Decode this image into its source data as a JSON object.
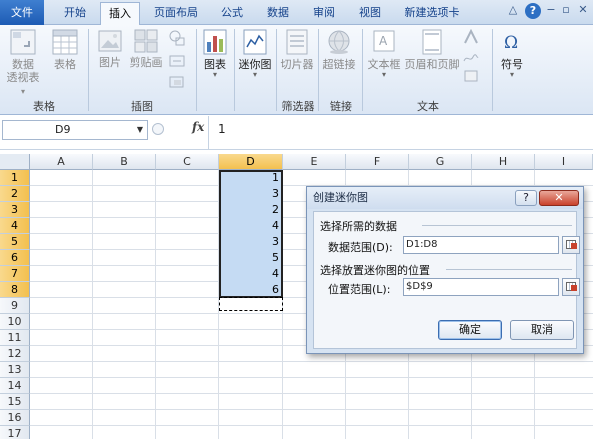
{
  "tabs": [
    {
      "label": "文件"
    },
    {
      "label": "开始"
    },
    {
      "label": "插入"
    },
    {
      "label": "页面布局"
    },
    {
      "label": "公式"
    },
    {
      "label": "数据"
    },
    {
      "label": "审阅"
    },
    {
      "label": "视图"
    },
    {
      "label": "新建选项卡"
    }
  ],
  "window_controls": {
    "caret": "△",
    "help": "?",
    "minimize": "−",
    "restore": "▫",
    "close": "✕"
  },
  "ribbon": {
    "pivot_label_1": "数据",
    "pivot_label_2": "透视表",
    "table": "表格",
    "picture": "图片",
    "clipart": "剪贴画",
    "chart": "图表",
    "sparkline": "迷你图",
    "slicer": "切片器",
    "hyperlink": "超链接",
    "textbox": "文本框",
    "header_footer": "页眉和页脚",
    "symbol": "符号",
    "groups": {
      "tables": "表格",
      "illustrations": "插图",
      "filter": "筛选器",
      "links": "链接",
      "text": "文本"
    }
  },
  "formula_bar": {
    "name_box": "D9",
    "fx": "fx",
    "value": "1"
  },
  "grid": {
    "columns": [
      "A",
      "B",
      "C",
      "D",
      "E",
      "F",
      "G",
      "H",
      "I"
    ],
    "rows": [
      "1",
      "2",
      "3",
      "4",
      "5",
      "6",
      "7",
      "8",
      "9",
      "10",
      "11",
      "12",
      "13",
      "14",
      "15",
      "16",
      "17"
    ],
    "d_values": [
      "1",
      "3",
      "2",
      "4",
      "3",
      "5",
      "4",
      "6"
    ]
  },
  "dialog": {
    "title": "创建迷你图",
    "help": "?",
    "close": "✕",
    "data_section": "选择所需的数据",
    "data_range_label": "数据范围(D):",
    "data_range_value": "D1:D8",
    "location_section": "选择放置迷你图的位置",
    "location_range_label": "位置范围(L):",
    "location_range_value": "$D$9",
    "ok": "确定",
    "cancel": "取消"
  }
}
